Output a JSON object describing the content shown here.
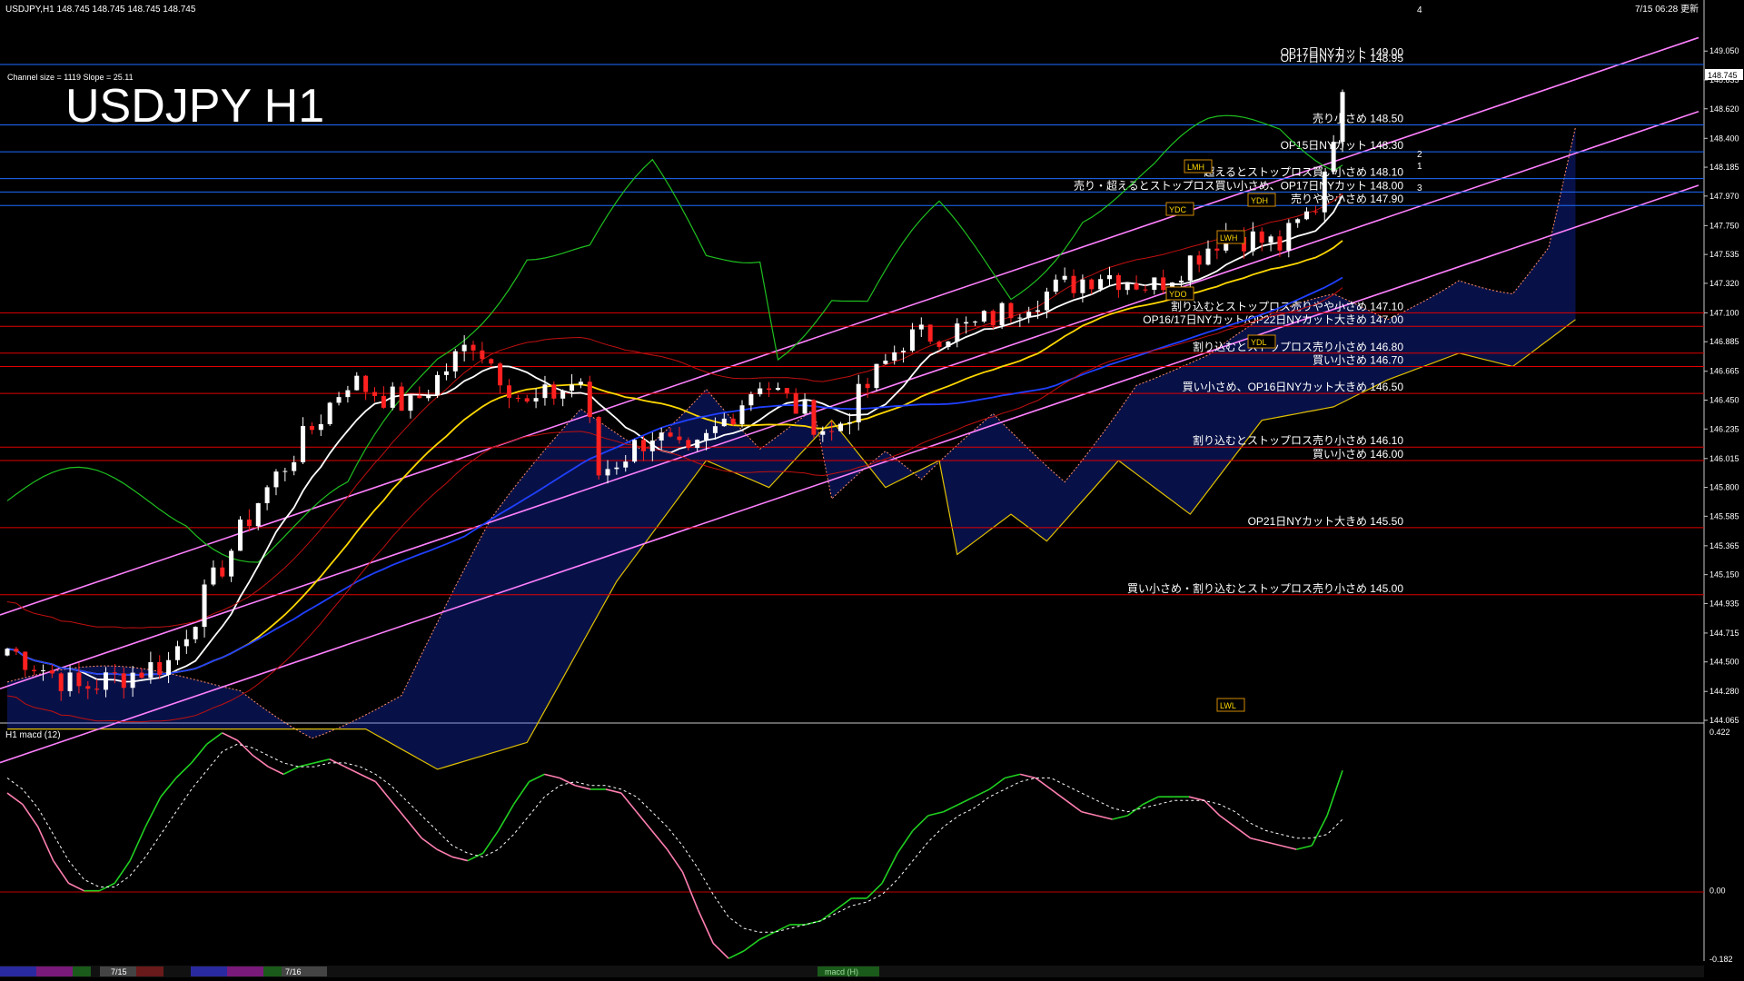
{
  "window": {
    "symbol_info": "USDJPY,H1  148.745 148.745 148.745 148.745",
    "updated": "7/15 06:28 更新",
    "channel_info": "Channel size = 1119 Slope = 25.11",
    "big_title": "USDJPY H1",
    "macd_label": "H1  macd (12)",
    "current_price_tag": "148.745"
  },
  "colors": {
    "background": "#000000",
    "bull_candle": "#ffffff",
    "bear_candle": "#ff2020",
    "level_line": "#e00000",
    "cut_line": "#1e6bff",
    "channel": "#ff80ff",
    "ichimoku_cloud_bull": "#ff8c6a",
    "ichimoku_cloud_bear": "#1c3cff",
    "ma_white": "#ffffff",
    "ma_yellow": "#ffd800",
    "ma_blue": "#2040ff",
    "chikou": "#1fbf1f",
    "macd_up": "#20d020",
    "macd_down": "#ff7fb0",
    "macd_signal": "#ffffff"
  },
  "chart_data": {
    "type": "candlestick",
    "symbol": "USDJPY",
    "timeframe": "H1",
    "ylim": [
      144.065,
      149.268
    ],
    "y_ticks": [
      "149.050",
      "148.835",
      "148.620",
      "148.400",
      "148.185",
      "147.970",
      "147.750",
      "147.535",
      "147.320",
      "147.100",
      "146.885",
      "146.665",
      "146.450",
      "146.235",
      "146.015",
      "145.800",
      "145.585",
      "145.365",
      "145.150",
      "144.935",
      "144.715",
      "144.500",
      "144.280",
      "144.065"
    ],
    "levels": [
      {
        "text": "OP17日NYカット 148.95",
        "value": 148.95,
        "kind": "cut"
      },
      {
        "text": "売り小さめ 148.50",
        "value": 148.5,
        "kind": "cut"
      },
      {
        "text": "OP15日NYカット 148.30",
        "value": 148.3,
        "kind": "cut"
      },
      {
        "text": "超えるとストップロス買い小さめ 148.10",
        "value": 148.1,
        "kind": "cut"
      },
      {
        "text": "売り・超えるとストップロス買い小さめ、OP17日NYカット 148.00",
        "value": 148.0,
        "kind": "cut"
      },
      {
        "text": "売りやや小さめ 147.90",
        "value": 147.9,
        "kind": "cut"
      },
      {
        "text": "割り込むとストップロス売りやや小さめ 147.10",
        "value": 147.1,
        "kind": "level"
      },
      {
        "text": "OP16/17日NYカット/OP22日NYカット大きめ 147.00",
        "value": 147.0,
        "kind": "level"
      },
      {
        "text": "割り込むとストップロス売り小さめ 146.80",
        "value": 146.8,
        "kind": "level"
      },
      {
        "text": "買い小さめ 146.70",
        "value": 146.7,
        "kind": "level"
      },
      {
        "text": "買い小さめ、OP16日NYカット大きめ 146.50",
        "value": 146.5,
        "kind": "level"
      },
      {
        "text": "割り込むとストップロス売り小さめ 146.10",
        "value": 146.1,
        "kind": "level"
      },
      {
        "text": "買い小さめ 146.00",
        "value": 146.0,
        "kind": "level"
      },
      {
        "text": "OP21日NYカット大きめ 145.50",
        "value": 145.5,
        "kind": "level"
      },
      {
        "text": "買い小さめ・割り込むとストップロス売り小さめ 145.00",
        "value": 145.0,
        "kind": "level"
      }
    ],
    "level_extra_text": "OP17日NYカット 149.00",
    "channel_numbers": [
      "4",
      "2",
      "1",
      "3"
    ],
    "macd": {
      "ylim": [
        -0.182,
        0.422
      ],
      "y_ticks": [
        "0.422",
        "0.00",
        "-0.182"
      ],
      "macd": [
        0.26,
        0.23,
        0.17,
        0.08,
        0.02,
        0.0,
        0.0,
        0.02,
        0.08,
        0.17,
        0.25,
        0.3,
        0.34,
        0.39,
        0.42,
        0.4,
        0.36,
        0.33,
        0.31,
        0.33,
        0.34,
        0.35,
        0.33,
        0.31,
        0.29,
        0.24,
        0.19,
        0.14,
        0.11,
        0.09,
        0.08,
        0.1,
        0.16,
        0.23,
        0.29,
        0.31,
        0.3,
        0.28,
        0.27,
        0.27,
        0.26,
        0.21,
        0.16,
        0.11,
        0.05,
        -0.05,
        -0.14,
        -0.18,
        -0.16,
        -0.13,
        -0.11,
        -0.09,
        -0.09,
        -0.08,
        -0.05,
        -0.02,
        -0.02,
        0.02,
        0.1,
        0.16,
        0.2,
        0.21,
        0.23,
        0.25,
        0.27,
        0.3,
        0.31,
        0.3,
        0.27,
        0.24,
        0.21,
        0.2,
        0.19,
        0.2,
        0.23,
        0.25,
        0.25,
        0.25,
        0.24,
        0.2,
        0.17,
        0.14,
        0.13,
        0.12,
        0.11,
        0.12,
        0.2,
        0.32
      ],
      "signal": [
        0.3,
        0.27,
        0.22,
        0.15,
        0.08,
        0.03,
        0.01,
        0.01,
        0.04,
        0.09,
        0.15,
        0.21,
        0.27,
        0.32,
        0.37,
        0.39,
        0.38,
        0.36,
        0.34,
        0.33,
        0.33,
        0.34,
        0.34,
        0.33,
        0.31,
        0.28,
        0.24,
        0.2,
        0.16,
        0.12,
        0.1,
        0.09,
        0.11,
        0.15,
        0.2,
        0.25,
        0.28,
        0.29,
        0.28,
        0.28,
        0.27,
        0.25,
        0.21,
        0.17,
        0.12,
        0.06,
        -0.01,
        -0.07,
        -0.1,
        -0.11,
        -0.11,
        -0.1,
        -0.09,
        -0.08,
        -0.06,
        -0.04,
        -0.03,
        -0.01,
        0.03,
        0.08,
        0.13,
        0.17,
        0.2,
        0.22,
        0.25,
        0.27,
        0.29,
        0.3,
        0.3,
        0.28,
        0.26,
        0.24,
        0.22,
        0.21,
        0.22,
        0.23,
        0.24,
        0.24,
        0.24,
        0.23,
        0.21,
        0.18,
        0.16,
        0.15,
        0.14,
        0.14,
        0.15,
        0.19
      ]
    },
    "date_labels": [
      "7/15",
      "7/16"
    ],
    "status_badge": "macd (H)"
  }
}
